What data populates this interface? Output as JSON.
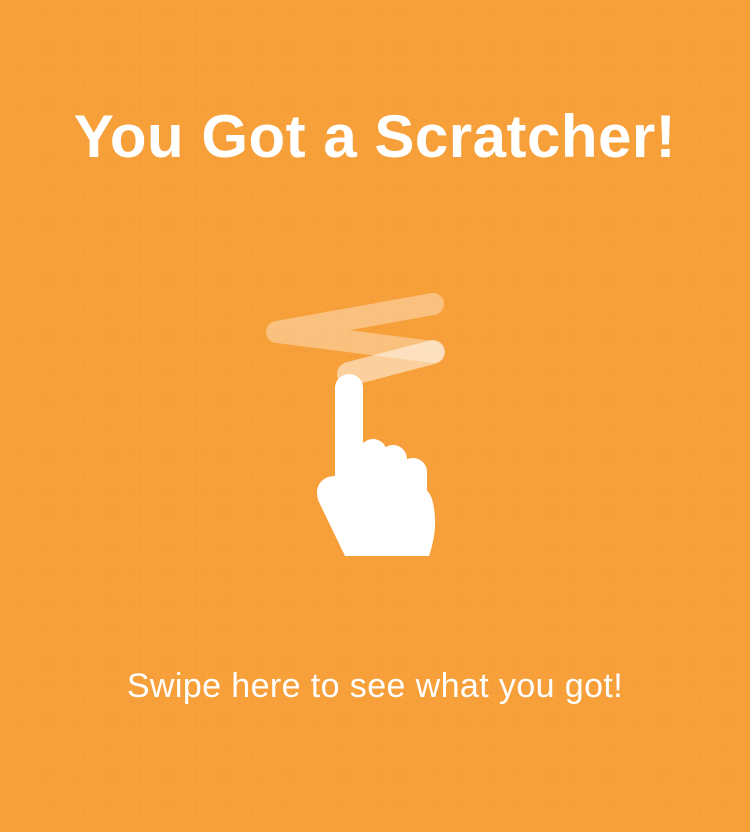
{
  "screen": {
    "title": "You Got a Scratcher!",
    "instruction": "Swipe here to see what you got!",
    "icon": "swipe-gesture-hand-icon"
  },
  "colors": {
    "background": "#f7a03a",
    "text": "#ffffff",
    "icon": "#ffffff"
  }
}
